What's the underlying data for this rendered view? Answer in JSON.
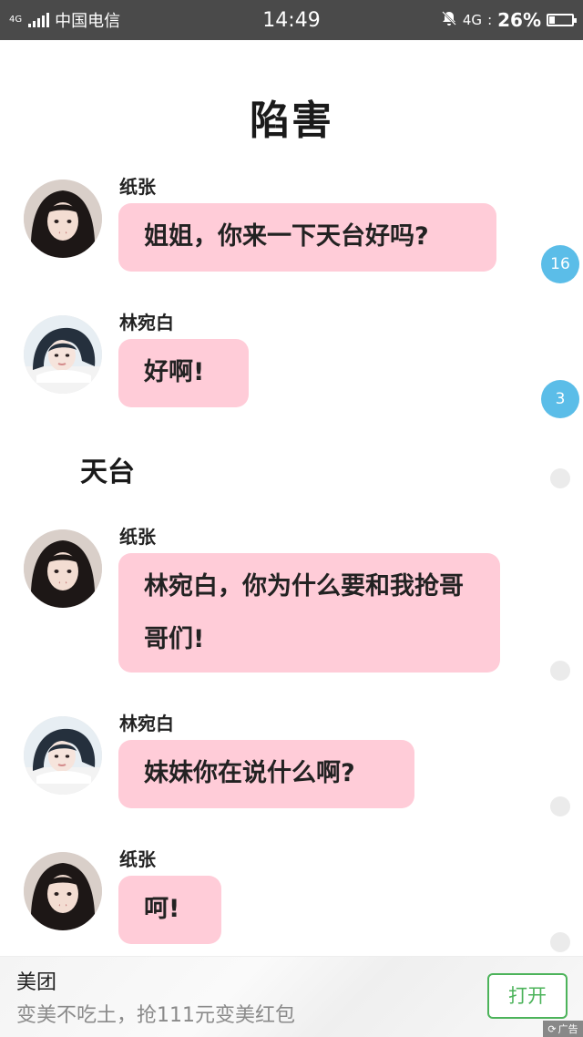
{
  "status_bar": {
    "network_type": "4G",
    "carrier": "中国电信",
    "time": "14:49",
    "data_label": "4G",
    "battery": "26%",
    "battery_level": 0.26
  },
  "story": {
    "title": "陷害",
    "scene_label": "天台"
  },
  "messages": [
    {
      "speaker": "纸张",
      "text": "姐姐，你来一下天台好吗?"
    },
    {
      "speaker": "林宛白",
      "text": "好啊!"
    },
    {
      "speaker": "纸张",
      "text": "林宛白，你为什么要和我抢哥哥们!"
    },
    {
      "speaker": "林宛白",
      "text": "妹妹你在说什么啊?"
    },
    {
      "speaker": "纸张",
      "text": "呵!"
    }
  ],
  "comment_counts": [
    "16",
    "3"
  ],
  "ad": {
    "brand": "美团",
    "text": "变美不吃土，抢111元变美红包",
    "open_label": "打开",
    "tag": "广告"
  },
  "colors": {
    "bubble": "#ffccd8",
    "badge": "#5bbde8",
    "open_button": "#4cb35a",
    "status_bar": "#4a4a4a"
  }
}
